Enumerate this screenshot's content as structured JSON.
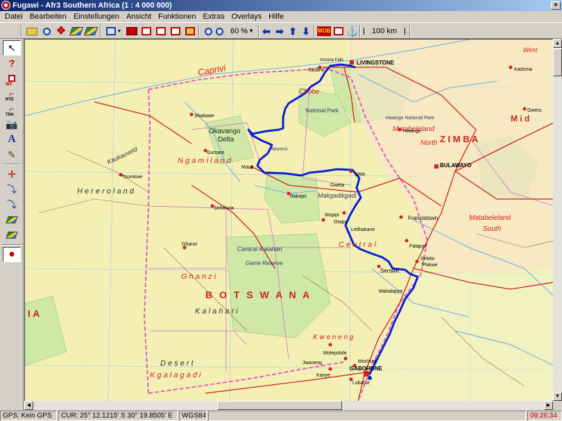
{
  "window": {
    "title": "Fugawi - Afr3  Southern Africa  (1 : 4 000 000)",
    "close_glyph": "×"
  },
  "menu": [
    "Datei",
    "Bearbeiten",
    "Einstellungen",
    "Ansicht",
    "Funktionen",
    "Extras",
    "Overlays",
    "Hilfe"
  ],
  "toolbar": {
    "zoom_value": "60 %",
    "mob_label": "MOB",
    "scale_label": "100 km"
  },
  "left_tools": {
    "wp_label": "WP",
    "rte_label": "RTE",
    "trk_label": "TRK"
  },
  "map": {
    "country_labels": {
      "botswana": "B O T S W A N A",
      "namibia_fragment": "I A",
      "zimbabwe": "Z  I  M  B  A"
    },
    "region_labels": {
      "caprivi": "Caprivi",
      "chobe": "Chobe",
      "ngamiland": "N g a m i l a n d",
      "central": "C e n t r a l",
      "ghanzi": "G h a n z i",
      "kgalagadi": "K g a l a g a d i",
      "kweneng": "K w e n e n g",
      "matabeleland_north": "Matabeleland\nNorth",
      "matabeleland_south": "Matabeleland\nSouth",
      "kalahari": "K a l a h a r i",
      "desert": "D e s e r t",
      "hereroland": "H e r e r o l a n d",
      "okavango": "Okavango",
      "delta": "Delta",
      "kaukauveld": "Kaukauveld",
      "central_kalahari": "Central Kalahari",
      "game_reserve": "Game Reserve",
      "makgadikgadi": "Makgadikgadi",
      "national_park": "National Park",
      "moremi": "Moremi",
      "hwange": "Hwange National Park",
      "west": "West",
      "midlands": "M i d"
    },
    "cities": {
      "livingstone": "LIVINGSTONE",
      "victoria_falls": "Victoria Falls",
      "bulawayo": "BULAWAYO",
      "gaborone": "GABORONE",
      "francistown": "Francistown",
      "serowe": "Serowe",
      "maun": "Maun",
      "ghanzi_town": "Ghanzi",
      "kasane": "Kasane",
      "palapye": "Palapye",
      "kanye": "Kanye",
      "molepolole": "Molepolole",
      "mochudi": "Mochudi",
      "nata": "Nata",
      "orapa": "Orapa",
      "letlhakane": "Letlhakane",
      "selebi_phikwe": "Selebi-\nPhikwe",
      "mahalapye": "Mahalapye",
      "kadoma": "Kadoma",
      "gweru": "Gweru",
      "hwange_town": "Hwange",
      "tsumkwe": "Tsumkwe",
      "sehithwa": "Sehithwa",
      "gumare": "Gumare",
      "shakawe": "Shakawe",
      "rakops": "Rakops",
      "mopipi": "Mopipi",
      "gweta": "Gweta",
      "lobatse": "Lobatse",
      "jwaneng": "Jwaneng"
    },
    "colors": {
      "land": "#f4f0b4",
      "park": "#cfe8a8",
      "boundary_pink": "#e060c0",
      "road_red": "#d02020",
      "water": "#6aa8e8",
      "track_blue": "#0a1fd8"
    }
  },
  "status": {
    "gps": "GPS: Kein GPS",
    "cursor": "CUR: 25° 12.1215' S 30° 19.8505' E",
    "datum": "WGS84",
    "time": "09:26:34"
  }
}
